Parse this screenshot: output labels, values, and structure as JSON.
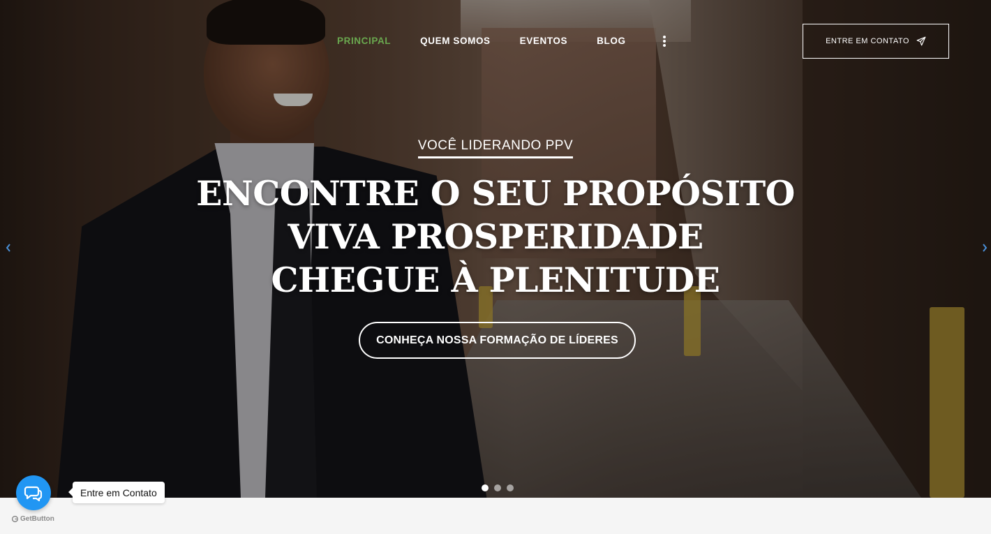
{
  "nav": {
    "items": [
      {
        "label": "PRINCIPAL",
        "active": true
      },
      {
        "label": "QUEM SOMOS",
        "active": false
      },
      {
        "label": "EVENTOS",
        "active": false
      },
      {
        "label": "BLOG",
        "active": false
      }
    ],
    "more_icon": "vertical-ellipsis-icon",
    "active_color": "#6aa84f"
  },
  "header": {
    "contact_button_label": "ENTRE EM CONTATO",
    "contact_button_icon": "paper-plane-icon"
  },
  "hero": {
    "eyebrow": "VOCÊ LIDERANDO PPV",
    "headline_lines": [
      "ENCONTRE O SEU PROPÓSITO",
      "VIVA PROSPERIDADE",
      "CHEGUE À PLENITUDE"
    ],
    "cta_label": "CONHEÇA NOSSA FORMAÇÃO DE LÍDERES",
    "prev_icon": "chevron-left-icon",
    "next_icon": "chevron-right-icon",
    "slides": 3,
    "active_slide": 1,
    "arrow_color": "#4a90d9"
  },
  "widget": {
    "tooltip": "Entre em Contato",
    "brand": "GetButton",
    "button_icon": "chat-bubbles-icon",
    "button_color": "#2196f3"
  }
}
